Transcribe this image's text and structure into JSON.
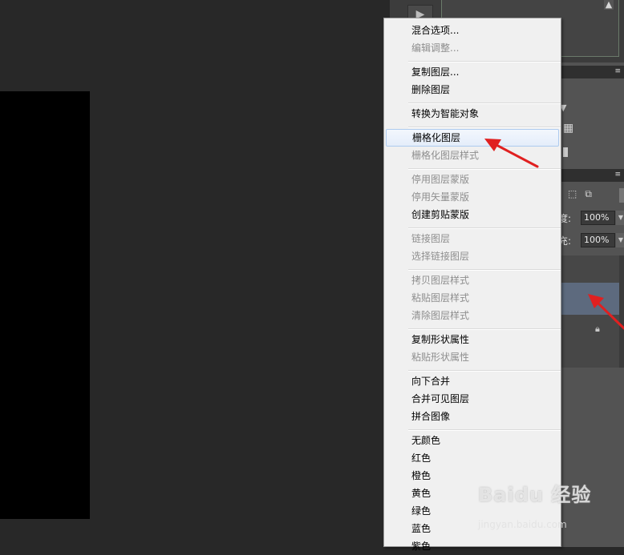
{
  "panels": {
    "opacity_label": "度:",
    "opacity_value": "100%",
    "fill_label": "充:",
    "fill_value": "100%"
  },
  "context_menu": {
    "items": [
      {
        "label": "混合选项...",
        "enabled": true
      },
      {
        "label": "编辑调整...",
        "enabled": false
      },
      {
        "label": "复制图层...",
        "enabled": true
      },
      {
        "label": "删除图层",
        "enabled": true
      },
      {
        "label": "转换为智能对象",
        "enabled": true
      },
      {
        "label": "栅格化图层",
        "enabled": true,
        "highlighted": true
      },
      {
        "label": "栅格化图层样式",
        "enabled": false
      },
      {
        "label": "停用图层蒙版",
        "enabled": false
      },
      {
        "label": "停用矢量蒙版",
        "enabled": false
      },
      {
        "label": "创建剪贴蒙版",
        "enabled": true
      },
      {
        "label": "链接图层",
        "enabled": false
      },
      {
        "label": "选择链接图层",
        "enabled": false
      },
      {
        "label": "拷贝图层样式",
        "enabled": false
      },
      {
        "label": "粘贴图层样式",
        "enabled": false
      },
      {
        "label": "清除图层样式",
        "enabled": false
      },
      {
        "label": "复制形状属性",
        "enabled": true
      },
      {
        "label": "粘贴形状属性",
        "enabled": false
      },
      {
        "label": "向下合并",
        "enabled": true
      },
      {
        "label": "合并可见图层",
        "enabled": true
      },
      {
        "label": "拼合图像",
        "enabled": true
      },
      {
        "label": "无颜色",
        "enabled": true
      },
      {
        "label": "红色",
        "enabled": true
      },
      {
        "label": "橙色",
        "enabled": true
      },
      {
        "label": "黄色",
        "enabled": true
      },
      {
        "label": "绿色",
        "enabled": true
      },
      {
        "label": "蓝色",
        "enabled": true
      },
      {
        "label": "紫色",
        "enabled": true
      }
    ]
  },
  "watermark": {
    "brand": "Baidu 经验",
    "url": "jingyan.baidu.com"
  },
  "colors": {
    "annotation_arrow": "#e02020",
    "menu_highlight_border": "#aecbef"
  }
}
